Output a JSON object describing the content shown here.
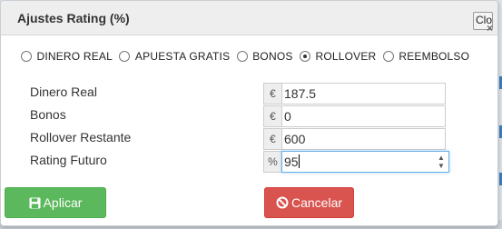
{
  "dialog": {
    "title": "Ajustes Rating (%)",
    "close_label": "Close",
    "close_glyph": "×"
  },
  "radios": [
    {
      "label": "DINERO REAL",
      "checked": false
    },
    {
      "label": "APUESTA GRATIS",
      "checked": false
    },
    {
      "label": "BONOS",
      "checked": false
    },
    {
      "label": "ROLLOVER",
      "checked": true
    },
    {
      "label": "REEMBOLSO",
      "checked": false
    }
  ],
  "fields": {
    "dinero_real": {
      "label": "Dinero Real",
      "addon": "€",
      "value": "187.5"
    },
    "bonos": {
      "label": "Bonos",
      "addon": "€",
      "value": "0"
    },
    "rollover_restante": {
      "label": "Rollover Restante",
      "addon": "€",
      "value": "600"
    },
    "rating_futuro": {
      "label": "Rating Futuro",
      "addon": "%",
      "value": "95"
    }
  },
  "buttons": {
    "apply_label": "Aplicar",
    "cancel_label": "Cancelar"
  },
  "icons": {
    "apply": "floppy-disk-icon",
    "cancel": "ban-icon",
    "close": "close-x-icon"
  },
  "colors": {
    "apply": "#5cb85c",
    "cancel": "#d9534f",
    "focus_border": "#66afe9"
  }
}
